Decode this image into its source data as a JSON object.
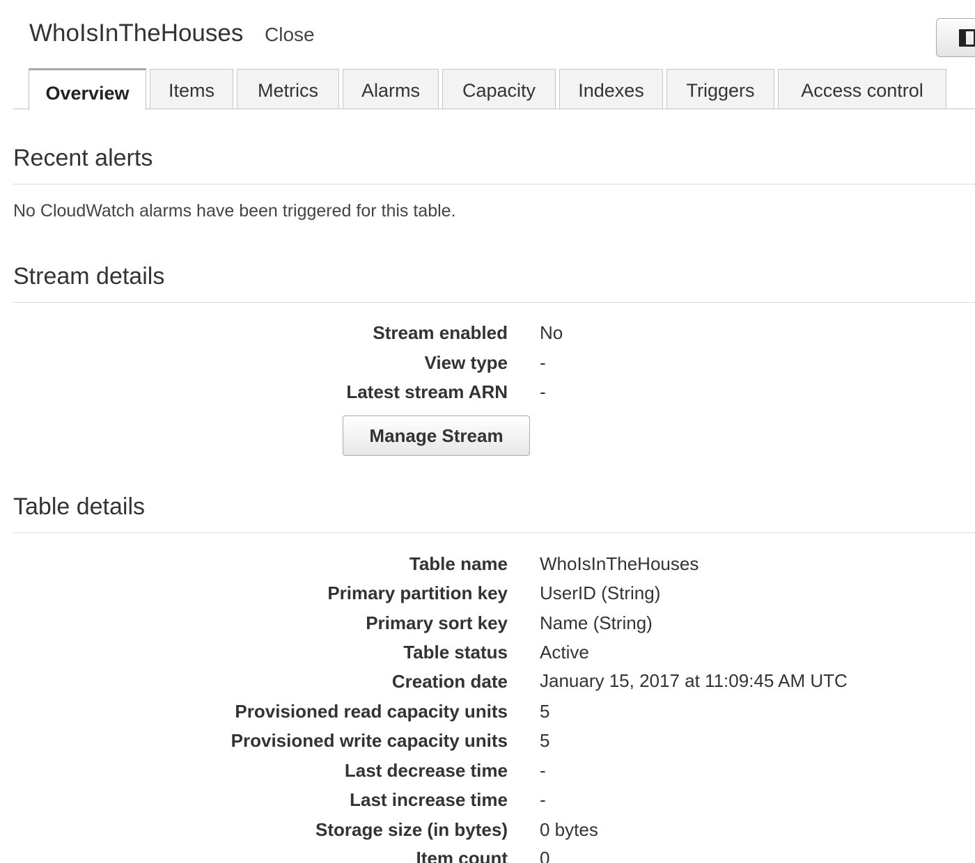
{
  "header": {
    "table_name": "WhoIsInTheHouses",
    "close_label": "Close"
  },
  "tabs": [
    {
      "label": "Overview",
      "active": true
    },
    {
      "label": "Items",
      "active": false
    },
    {
      "label": "Metrics",
      "active": false
    },
    {
      "label": "Alarms",
      "active": false
    },
    {
      "label": "Capacity",
      "active": false
    },
    {
      "label": "Indexes",
      "active": false
    },
    {
      "label": "Triggers",
      "active": false
    },
    {
      "label": "Access control",
      "active": false
    }
  ],
  "recent_alerts": {
    "heading": "Recent alerts",
    "message": "No CloudWatch alarms have been triggered for this table."
  },
  "stream_details": {
    "heading": "Stream details",
    "rows": [
      {
        "label": "Stream enabled",
        "value": "No"
      },
      {
        "label": "View type",
        "value": "-"
      },
      {
        "label": "Latest stream ARN",
        "value": "-"
      }
    ],
    "manage_button_label": "Manage Stream"
  },
  "table_details": {
    "heading": "Table details",
    "rows": [
      {
        "label": "Table name",
        "value": "WhoIsInTheHouses"
      },
      {
        "label": "Primary partition key",
        "value": "UserID (String)"
      },
      {
        "label": "Primary sort key",
        "value": "Name (String)"
      },
      {
        "label": "Table status",
        "value": "Active"
      },
      {
        "label": "Creation date",
        "value": "January 15, 2017 at 11:09:45 AM UTC"
      },
      {
        "label": "Provisioned read capacity units",
        "value": "5"
      },
      {
        "label": "Provisioned write capacity units",
        "value": "5"
      },
      {
        "label": "Last decrease time",
        "value": "-"
      },
      {
        "label": "Last increase time",
        "value": "-"
      },
      {
        "label": "Storage size (in bytes)",
        "value": "0 bytes"
      },
      {
        "label": "Item count",
        "value": "0"
      }
    ]
  },
  "icons": {
    "panel_toggle": "panel-toggle-icon"
  }
}
